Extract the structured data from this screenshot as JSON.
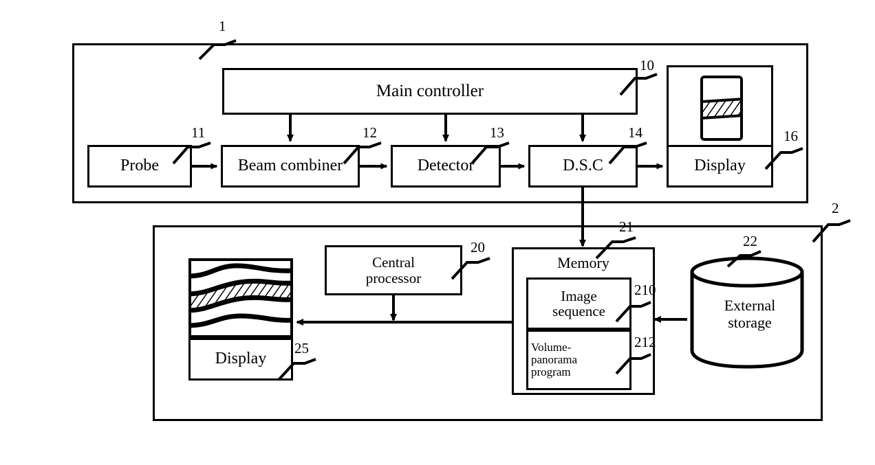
{
  "figure": {
    "type": "patent-block-diagram",
    "background": "#ffffff",
    "line_color": "#000000"
  },
  "systems": {
    "upper": {
      "ref": "1",
      "name": "ultrasound-imaging-system"
    },
    "lower": {
      "ref": "2",
      "name": "volume-panorama-workstation"
    }
  },
  "blocks": {
    "main_controller": {
      "label": "Main controller",
      "ref": "10"
    },
    "probe": {
      "label": "Probe",
      "ref": "11"
    },
    "beam_combiner": {
      "label": "Beam combiner",
      "ref": "12"
    },
    "detector": {
      "label": "Detector",
      "ref": "13"
    },
    "dsc": {
      "label": "D.S.C",
      "ref": "14"
    },
    "display_upper": {
      "label": "Display",
      "ref": "16"
    },
    "central_processor": {
      "label_line1": "Central",
      "label_line2": "processor",
      "ref": "20"
    },
    "memory": {
      "label": "Memory",
      "ref": "21"
    },
    "image_sequence": {
      "label_line1": "Image",
      "label_line2": "sequence",
      "ref": "210"
    },
    "volume_panorama_program": {
      "label_line1": "Volume-",
      "label_line2": "panorama",
      "label_line3": "program",
      "ref": "212"
    },
    "external_storage": {
      "label_line1": "External",
      "label_line2": "storage",
      "ref": "22"
    },
    "display_lower": {
      "label": "Display",
      "ref": "25"
    }
  },
  "screens": {
    "upper_screen": {
      "name": "ultrasound-slice-image",
      "hatched": true
    },
    "lower_screen": {
      "name": "volume-panorama-image",
      "hatched": true
    }
  },
  "connections": [
    {
      "from": "main_controller",
      "to": "beam_combiner",
      "arrow": "down"
    },
    {
      "from": "main_controller",
      "to": "detector",
      "arrow": "down"
    },
    {
      "from": "main_controller",
      "to": "dsc",
      "arrow": "down"
    },
    {
      "from": "probe",
      "to": "beam_combiner",
      "arrow": "right"
    },
    {
      "from": "beam_combiner",
      "to": "detector",
      "arrow": "right"
    },
    {
      "from": "detector",
      "to": "dsc",
      "arrow": "right"
    },
    {
      "from": "dsc",
      "to": "display_upper",
      "arrow": "right"
    },
    {
      "from": "dsc",
      "to": "memory",
      "arrow": "down"
    },
    {
      "from": "external_storage",
      "to": "memory",
      "arrow": "left"
    },
    {
      "from": "memory",
      "to": "display_lower",
      "arrow": "left"
    },
    {
      "from": "central_processor",
      "to": "memory_bus",
      "arrow": "down"
    }
  ]
}
